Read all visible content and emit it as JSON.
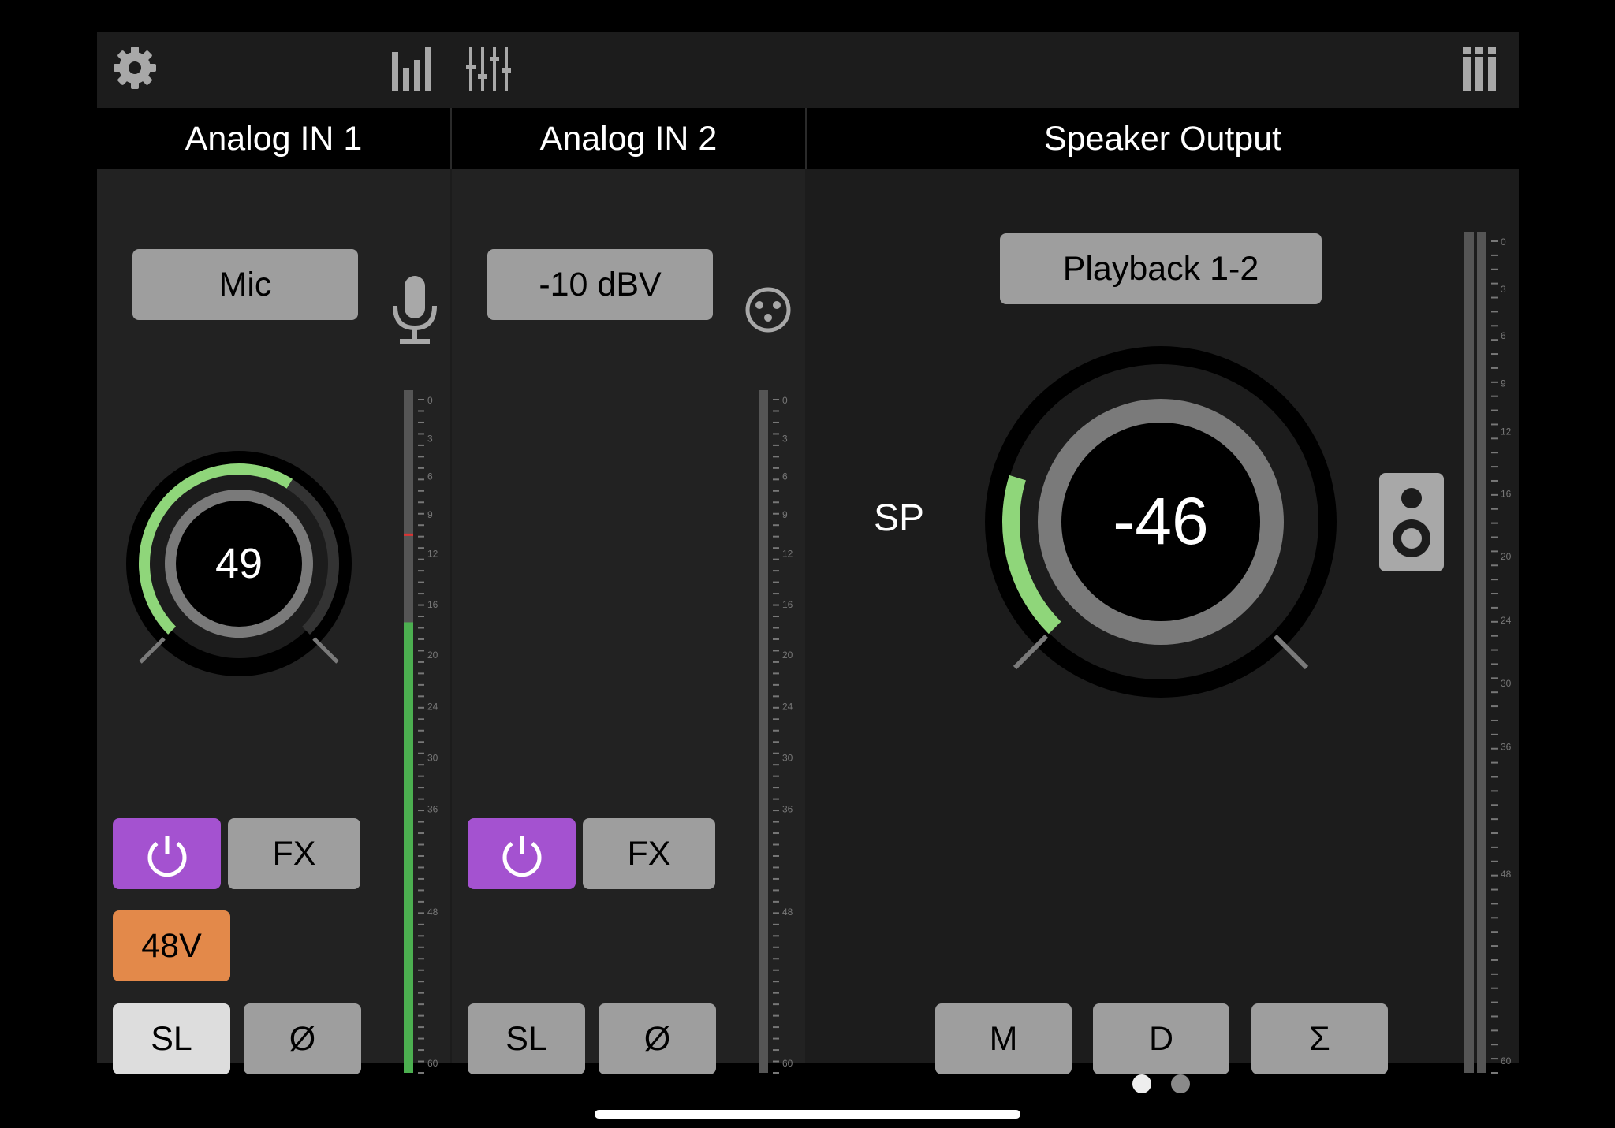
{
  "toolbar": {
    "icons": [
      "gear-icon",
      "meters-icon",
      "mixer-sliders-icon",
      "channel-layout-icon"
    ]
  },
  "channels": [
    {
      "title": "Analog IN 1",
      "input_source": "Mic",
      "input_icon": "microphone-icon",
      "gain_value": "49",
      "gain_fraction": 0.62,
      "power_active": true,
      "fx_label": "FX",
      "phantom_label": "48V",
      "phantom_on": true,
      "solo_label": "SL",
      "solo_on": true,
      "phase_label": "Ø",
      "meter_level": 0.66,
      "peak_hold": 0.79
    },
    {
      "title": "Analog IN 2",
      "input_source": "-10 dBV",
      "input_icon": "xlr-connector-icon",
      "power_active": true,
      "fx_label": "FX",
      "solo_label": "SL",
      "solo_on": false,
      "phase_label": "Ø",
      "meter_level": 0
    }
  ],
  "output": {
    "title": "Speaker Output",
    "source": "Playback 1-2",
    "side_label": "SP",
    "volume_value": "-46",
    "volume_fraction": 0.23,
    "output_icon": "speaker-icon",
    "buttons": [
      "M",
      "D",
      "Σ"
    ],
    "meter_level": 0
  },
  "meter_scale": [
    "0",
    "3",
    "6",
    "9",
    "12",
    "16",
    "20",
    "24",
    "30",
    "36",
    "48",
    "60"
  ],
  "page_indicator": {
    "pages": 2,
    "current": 1
  },
  "colors": {
    "accent_green": "#8fd67a",
    "meter_green": "#4caf50",
    "power_purple": "#a452d0",
    "phantom_orange": "#e3894a",
    "button_gray": "#9e9e9e",
    "solo_active": "#dddddd"
  }
}
